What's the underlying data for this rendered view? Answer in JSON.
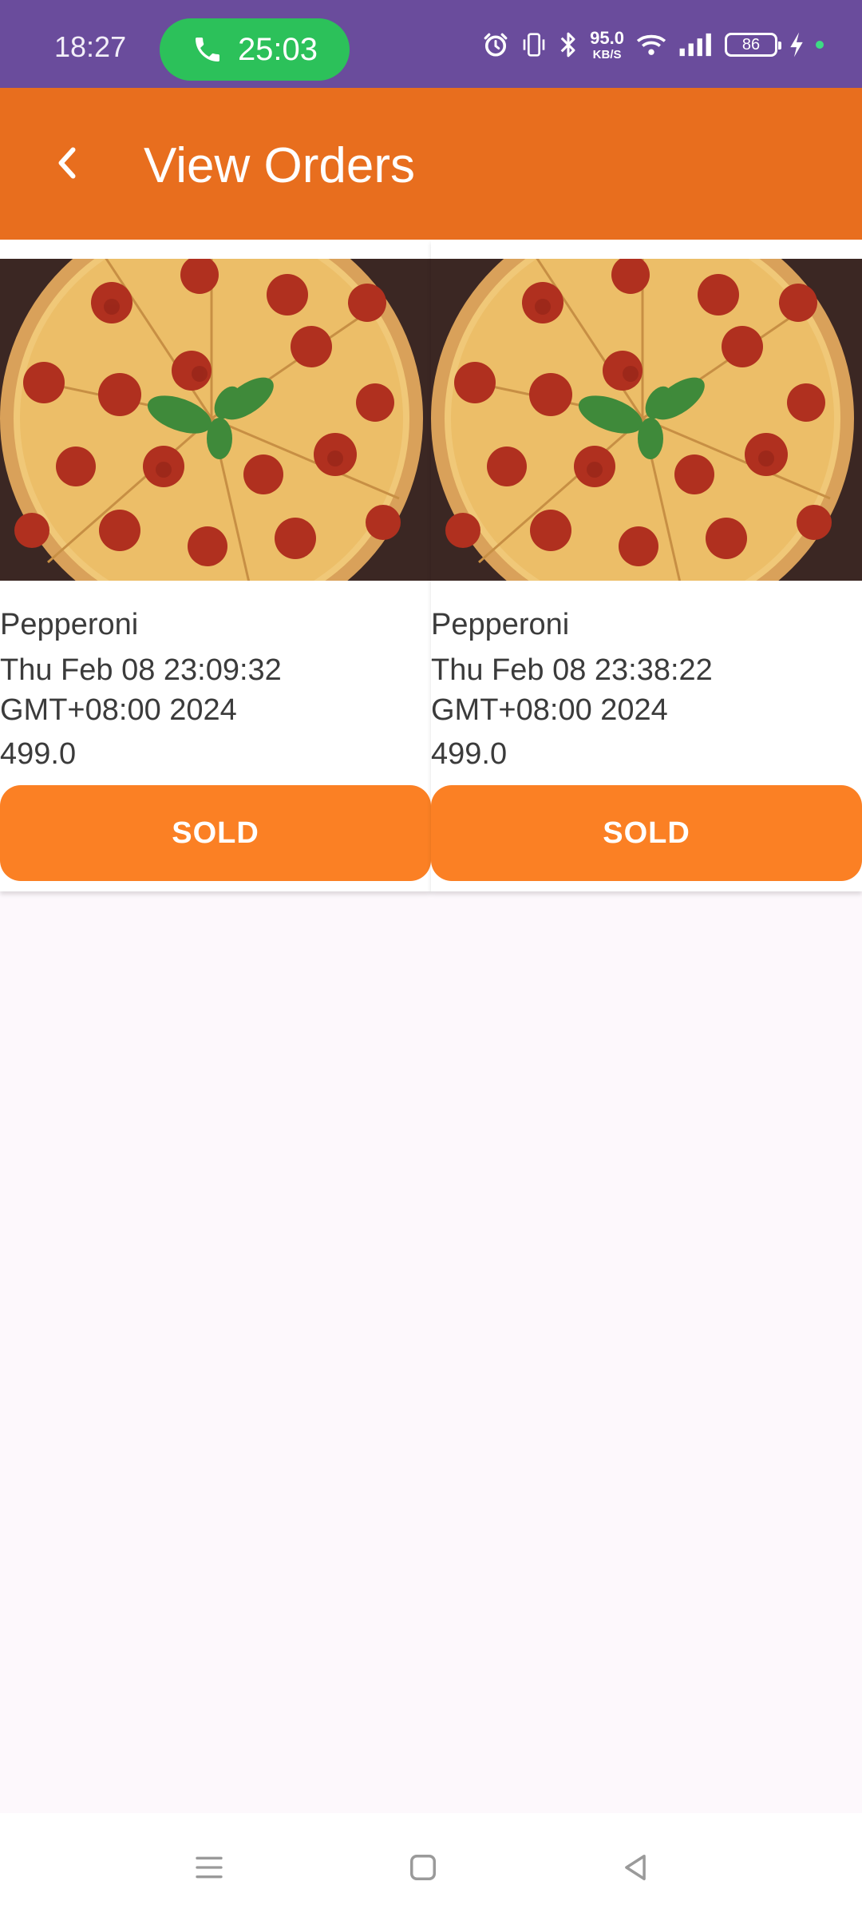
{
  "status_bar": {
    "time": "18:27",
    "call_timer": "25:03",
    "net_speed_value": "95.0",
    "net_speed_unit": "KB/S",
    "battery_level": "86",
    "icons": [
      "alarm-icon",
      "vibrate-icon",
      "bluetooth-icon",
      "wifi-icon",
      "signal-icon",
      "battery-icon",
      "charging-icon"
    ]
  },
  "app_bar": {
    "title": "View Orders",
    "back_icon": "chevron-left-icon"
  },
  "orders": [
    {
      "name": "Pepperoni",
      "date": "Thu Feb 08 23:09:32 GMT+08:00 2024",
      "price": "499.0",
      "button_label": "SOLD"
    },
    {
      "name": "Pepperoni",
      "date": "Thu Feb 08 23:38:22 GMT+08:00 2024",
      "price": "499.0",
      "button_label": "SOLD"
    }
  ],
  "nav_bar": {
    "icons": [
      "menu-icon",
      "home-square-icon",
      "back-triangle-icon"
    ]
  },
  "colors": {
    "status_bar": "#6a4c9c",
    "app_bar": "#e86e1e",
    "button": "#fb8024",
    "call_pill": "#2cc15a",
    "background": "#fdf8fc"
  }
}
